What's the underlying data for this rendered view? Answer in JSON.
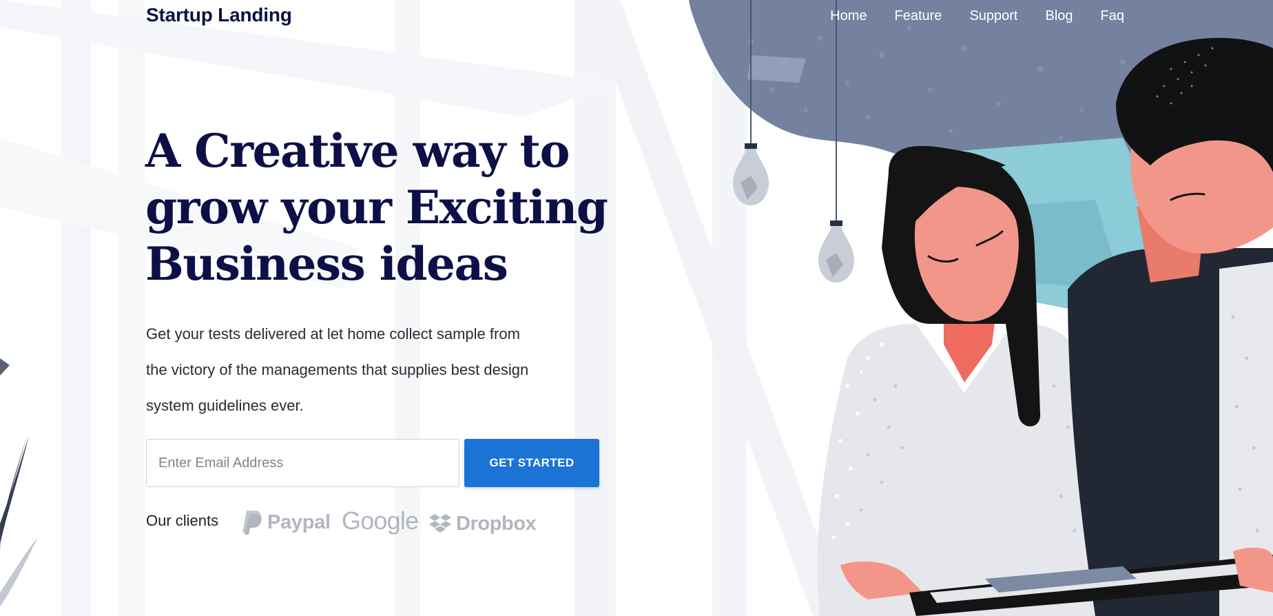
{
  "header": {
    "brand": "Startup Landing",
    "nav": [
      {
        "label": "Home"
      },
      {
        "label": "Feature"
      },
      {
        "label": "Support"
      },
      {
        "label": "Blog"
      },
      {
        "label": "Faq"
      }
    ]
  },
  "hero": {
    "headline_lines": [
      "A Creative way to",
      "grow your Exciting",
      "Business ideas"
    ],
    "description_lines": [
      "Get your tests delivered at let home collect sample from",
      "the victory of the managements that supplies best design",
      "system guidelines ever."
    ],
    "email_placeholder": "Enter Email Address",
    "cta_label": "GET STARTED"
  },
  "clients": {
    "label": "Our clients",
    "logos": [
      {
        "name": "Paypal",
        "icon": "paypal-icon"
      },
      {
        "name": "Google",
        "icon": "google-logo"
      },
      {
        "name": "Dropbox",
        "icon": "dropbox-icon"
      }
    ]
  },
  "colors": {
    "headline": "#0d0f47",
    "brand": "#0c1440",
    "cta": "#1b73d6",
    "logo_gray": "#b2b6bf",
    "cloud": "#7482a0"
  },
  "illustration": {
    "icons": [
      "light-bulb-icon",
      "light-bulb-icon"
    ],
    "figures": [
      "woman-figure",
      "man-figure",
      "tablet"
    ]
  }
}
